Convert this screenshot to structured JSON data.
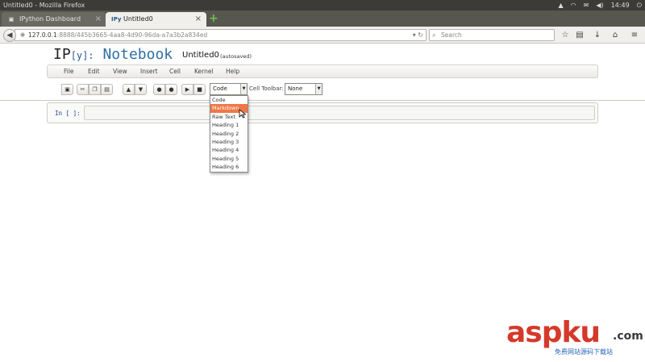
{
  "window": {
    "title": "Untitled0 - Mozilla Firefox",
    "clock": "14:49"
  },
  "tabs": [
    {
      "label": "IPython Dashboard",
      "favicon": "IP"
    },
    {
      "label": "Untitled0",
      "favicon": "IPy"
    }
  ],
  "nav": {
    "url_host": "127.0.0.1",
    "url_path": ":8888/445b3665-4aa8-4d90-96da-a7a3b2a834ed",
    "search_placeholder": "Search"
  },
  "header": {
    "logo_ip": "IP",
    "logo_y": "[y]:",
    "logo_notebook": "Notebook",
    "notebook_name": "Untitled0",
    "save_status": "(autosaved)"
  },
  "menubar": {
    "items": [
      "File",
      "Edit",
      "View",
      "Insert",
      "Cell",
      "Kernel",
      "Help"
    ]
  },
  "toolbar": {
    "cell_type_value": "Code",
    "cell_toolbar_label": "Cell Toolbar:",
    "cell_toolbar_value": "None"
  },
  "cell": {
    "prompt": "In [ ]:"
  },
  "dropdown": {
    "options": [
      "Code",
      "Markdown",
      "Raw Text",
      "Heading 1",
      "Heading 2",
      "Heading 3",
      "Heading 4",
      "Heading 5",
      "Heading 6"
    ],
    "highlighted_index": 1
  },
  "watermark": {
    "brand": "aspku",
    "tld": ".com",
    "tagline": "免费网站源码下载站"
  },
  "colors": {
    "highlight": "#f07746",
    "logo_blue": "#2e6fa6",
    "prompt_blue": "#1c3e94"
  }
}
